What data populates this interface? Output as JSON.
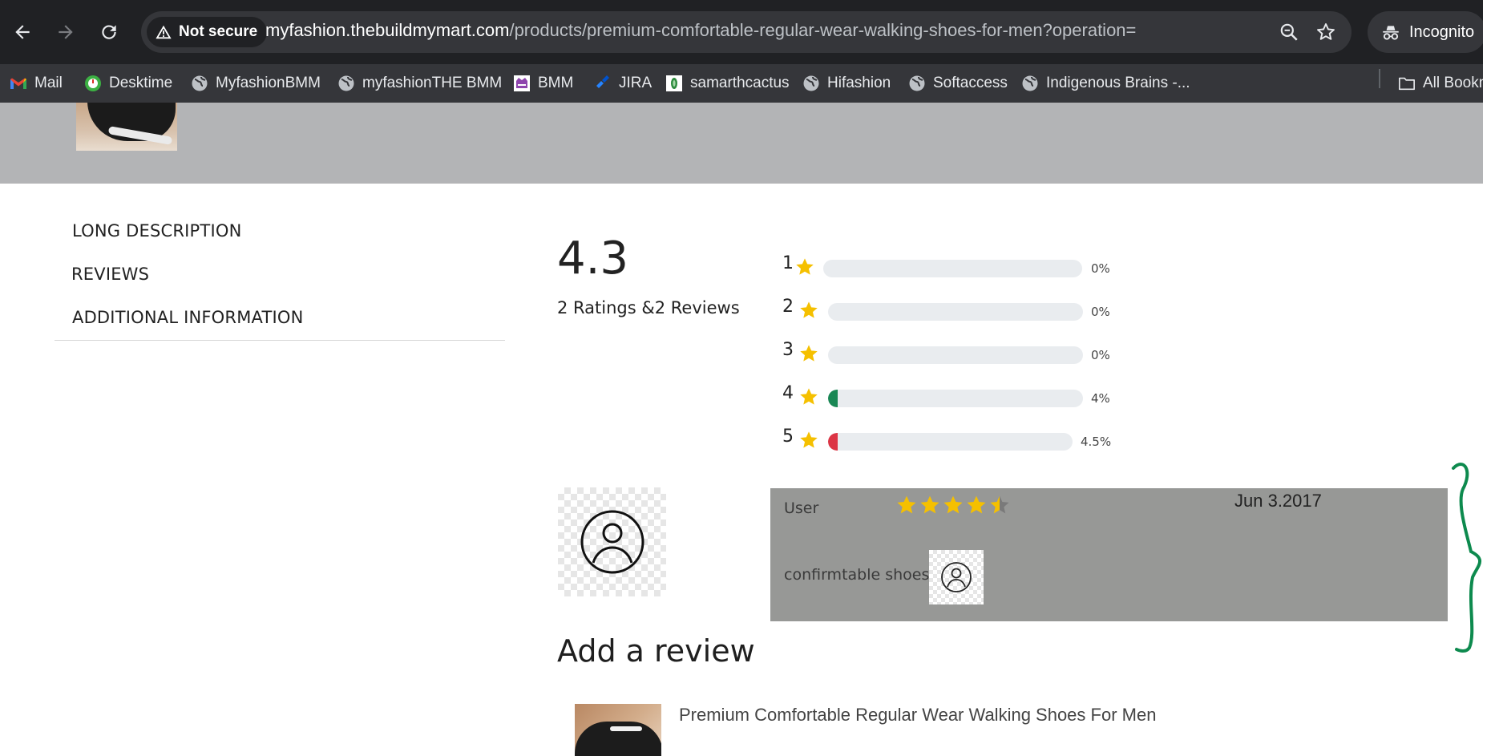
{
  "browser": {
    "security_label": "Not secure",
    "url_host": "myfashion.thebuildmymart.com",
    "url_path": "/products/premium-comfortable-regular-wear-walking-shoes-for-men?operation=",
    "incognito_label": "Incognito",
    "bookmarks": [
      {
        "label": "Mail",
        "icon": "gmail-icon"
      },
      {
        "label": "Desktime",
        "icon": "desktime-icon"
      },
      {
        "label": "MyfashionBMM",
        "icon": "globe-icon"
      },
      {
        "label": "myfashionTHE BMM",
        "icon": "globe-icon"
      },
      {
        "label": "BMM",
        "icon": "bmm-logo-icon"
      },
      {
        "label": "JIRA",
        "icon": "jira-icon"
      },
      {
        "label": "samarthcactus",
        "icon": "cactus-icon"
      },
      {
        "label": "Hifashion",
        "icon": "globe-icon"
      },
      {
        "label": "Softaccess",
        "icon": "globe-icon"
      },
      {
        "label": "Indigenous Brains -...",
        "icon": "globe-icon"
      }
    ],
    "all_bookmarks_label": "All Bookm"
  },
  "product_tabs": {
    "long_description": "LONG DESCRIPTION",
    "reviews": "REVIEWS",
    "additional_information": "ADDITIONAL INFORMATION"
  },
  "rating_summary": {
    "average": "4.3",
    "summary_text": "2 Ratings &2 Reviews",
    "breakdown": [
      {
        "stars": "1",
        "percent_label": "0%",
        "fill_fraction": 0.0,
        "fill_color": "#198754"
      },
      {
        "stars": "2",
        "percent_label": "0%",
        "fill_fraction": 0.0,
        "fill_color": "#198754"
      },
      {
        "stars": "3",
        "percent_label": "0%",
        "fill_fraction": 0.0,
        "fill_color": "#198754"
      },
      {
        "stars": "4",
        "percent_label": "4%",
        "fill_fraction": 0.04,
        "fill_color": "#198754"
      },
      {
        "stars": "5",
        "percent_label": "4.5%",
        "fill_fraction": 0.045,
        "fill_color": "#dc3545"
      }
    ],
    "star_color": "#f5c000"
  },
  "review": {
    "user": "User",
    "rating": 4.5,
    "date": "Jun 3.2017",
    "text": "confirmtable shoes"
  },
  "add_review": {
    "heading": "Add a review",
    "product_title": "Premium Comfortable Regular Wear Walking Shoes For Men"
  },
  "colors": {
    "chrome_dark": "#202124",
    "bookmarks_bar": "#35363a",
    "page_band": "#b3b4b6",
    "review_box": "#979896",
    "annotation": "#0d8a4e"
  }
}
